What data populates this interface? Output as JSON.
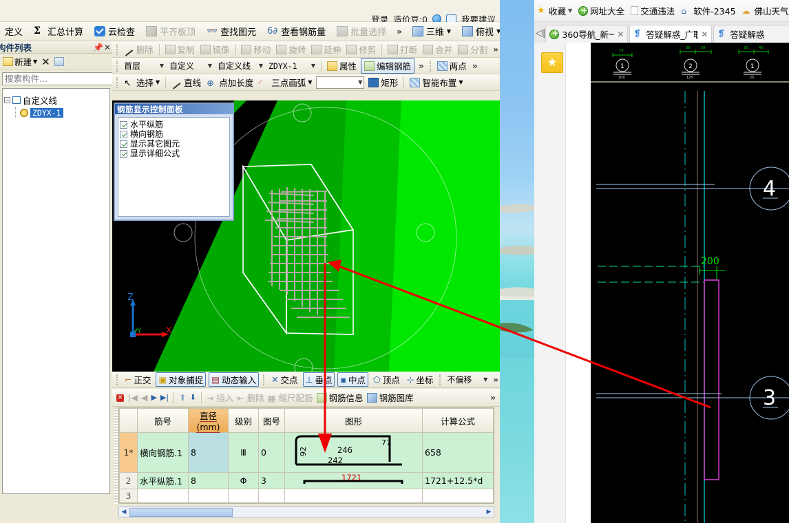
{
  "app": {
    "account": {
      "login_label": "登录",
      "coin_label": "造价豆:0",
      "bell_icon": "bell-icon",
      "suggest_label": "我要建议"
    },
    "menu": [
      {
        "label": "定义",
        "icon": "",
        "disabled": false
      },
      {
        "label": "汇总计算",
        "icon": "sigma-icon",
        "disabled": false
      },
      {
        "label": "云检查",
        "icon": "cloud-check-icon",
        "disabled": false
      },
      {
        "label": "平齐板顶",
        "icon": "flat-slab-icon",
        "disabled": true
      },
      {
        "label": "查找图元",
        "icon": "binoculars-icon",
        "disabled": false
      },
      {
        "label": "查看钢筋量",
        "icon": "glasses-icon",
        "disabled": false
      },
      {
        "label": "批量选择",
        "icon": "batch-select-icon",
        "disabled": true
      }
    ],
    "menu_overflow": "»",
    "view_buttons": [
      {
        "label": "三维",
        "icon": "cube-icon"
      },
      {
        "label": "俯视",
        "icon": "cube-top-icon"
      }
    ],
    "edit_toolbar": [
      {
        "label": "删除",
        "icon": "delete-icon",
        "disabled": true
      },
      {
        "label": "复制",
        "icon": "copy-icon",
        "disabled": true
      },
      {
        "label": "镜像",
        "icon": "mirror-icon",
        "disabled": true
      },
      {
        "label": "移动",
        "icon": "move-icon",
        "disabled": true
      },
      {
        "label": "旋转",
        "icon": "rotate-icon",
        "disabled": true
      },
      {
        "label": "延伸",
        "icon": "extend-icon",
        "disabled": true
      },
      {
        "label": "修剪",
        "icon": "trim-icon",
        "disabled": true
      },
      {
        "label": "打断",
        "icon": "break-icon",
        "disabled": true
      },
      {
        "label": "合并",
        "icon": "merge-icon",
        "disabled": true
      },
      {
        "label": "分割",
        "icon": "split-icon",
        "disabled": true
      }
    ],
    "selector_bar": {
      "floor": "首层",
      "category": "自定义",
      "type": "自定义线",
      "component": "ZDYX-1",
      "properties_label": "属性",
      "edit_rebar_label": "编辑钢筋",
      "two_point_label": "两点"
    },
    "draw_toolbar": {
      "select_label": "选择",
      "line_label": "直线",
      "point_len_label": "点加长度",
      "arc_label": "三点画弧",
      "blank_combo": "",
      "rect_label": "矩形",
      "smart_label": "智能布置"
    },
    "component_panel": {
      "title": "构件列表",
      "pin_icon": "pin-icon",
      "close_icon": "close-icon",
      "new_label": "新建",
      "delete_icon": "delete-x-icon",
      "copy_icon": "copy-icon",
      "search_placeholder": "搜索构件...",
      "search_icon": "search-icon",
      "tree": {
        "root_label": "自定义线",
        "child_label": "ZDYX-1"
      }
    },
    "rebar_display_panel": {
      "title": "钢筋显示控制面板",
      "options": [
        {
          "label": "水平纵筋",
          "checked": true
        },
        {
          "label": "横向钢筋",
          "checked": true
        },
        {
          "label": "显示其它图元",
          "checked": true
        },
        {
          "label": "显示详细公式",
          "checked": true
        }
      ]
    },
    "axis_labels": {
      "z": "Z",
      "y": "Y",
      "x": "X"
    },
    "snap_bar": {
      "items": [
        {
          "label": "正交",
          "icon": "ortho-icon",
          "active": false
        },
        {
          "label": "对象捕捉",
          "icon": "object-snap-icon",
          "active": true
        },
        {
          "label": "动态输入",
          "icon": "dynamic-input-icon",
          "active": true
        },
        {
          "label": "交点",
          "icon": "intersection-icon",
          "active": false
        },
        {
          "label": "垂点",
          "icon": "perpendicular-icon",
          "active": true
        },
        {
          "label": "中点",
          "icon": "midpoint-icon",
          "active": true
        },
        {
          "label": "顶点",
          "icon": "vertex-icon",
          "active": false
        },
        {
          "label": "坐标",
          "icon": "coordinate-icon",
          "active": false
        }
      ],
      "offset_combo": "不偏移",
      "overflow": "»"
    },
    "rebar_nav": {
      "close_icon": "close-icon",
      "first_icon": "first-record-icon",
      "prev_icon": "prev-record-icon",
      "next_icon": "next-record-icon",
      "last_icon": "last-record-icon",
      "up_icon": "move-up-icon",
      "down_icon": "move-down-icon",
      "insert_label": "插入",
      "delete_label": "删除",
      "shrink_label": "缩尺配筋",
      "info_label": "钢筋信息",
      "library_label": "钢筋图库",
      "overflow": "»"
    },
    "rebar_table": {
      "columns": [
        "",
        "筋号",
        "直径(mm)",
        "级别",
        "图号",
        "图形",
        "计算公式"
      ],
      "rows": [
        {
          "index": "1*",
          "name": "横向钢筋.1",
          "diameter": "8",
          "grade": "Ⅲ",
          "shape_no": "0",
          "shape": {
            "type": "u-hook",
            "left_label": "92",
            "right_label": "77",
            "top_label": "246",
            "bottom_label": "242"
          },
          "formula": "658"
        },
        {
          "index": "2",
          "name": "水平纵筋.1",
          "diameter": "8",
          "grade": "Φ",
          "shape_no": "3",
          "shape": {
            "type": "straight-dim",
            "dim_label": "1721"
          },
          "formula": "1721+12.5*d"
        },
        {
          "index": "3",
          "name": "",
          "diameter": "",
          "grade": "",
          "shape_no": "",
          "shape": {
            "type": "empty"
          },
          "formula": ""
        }
      ]
    }
  },
  "browser": {
    "bookmarks": [
      {
        "label": "收藏",
        "icon": "star-folder-icon",
        "caret": "▾"
      },
      {
        "label": "网址大全",
        "icon": "globe-360-icon"
      },
      {
        "label": "交通违法",
        "icon": "page-icon"
      },
      {
        "label": "软件-2345",
        "icon": "house-2345-icon"
      },
      {
        "label": "佛山天气",
        "icon": "weather-cloud-icon"
      }
    ],
    "tab_back_icon": "tab-scroll-left-icon",
    "tabs": [
      {
        "label": "360导航_新一",
        "favicon": "globe-360-icon",
        "active": false,
        "close_icon": "close-icon"
      },
      {
        "label": "答疑解惑_广联",
        "favicon": "qa-icon",
        "active": true,
        "close_icon": "close-icon"
      },
      {
        "label": "答疑解惑",
        "favicon": "qa-icon",
        "active": false,
        "close_icon": "close-icon"
      }
    ],
    "sidebar_star_icon": "favorite-star-icon",
    "cad_drawing": {
      "top_markers": [
        {
          "label": "1",
          "dim_above": "74",
          "dim_below": "100"
        },
        {
          "label": "2",
          "dim_above_left": "38",
          "dim_above_right": "39",
          "dim_below": "125"
        },
        {
          "label": "1",
          "dim_above_left": "30",
          "dim_above_right": "40",
          "dim_below": "25"
        }
      ],
      "dimension_label": "200",
      "grid_bubbles": [
        {
          "label": "4"
        },
        {
          "label": "3"
        }
      ]
    }
  },
  "colors": {
    "accent_blue": "#2f6fb5",
    "highlight_orange": "#eeab54",
    "table_green": "#ccf0d4",
    "annotation_red": "#ee0000",
    "model_green": "#00d900"
  }
}
